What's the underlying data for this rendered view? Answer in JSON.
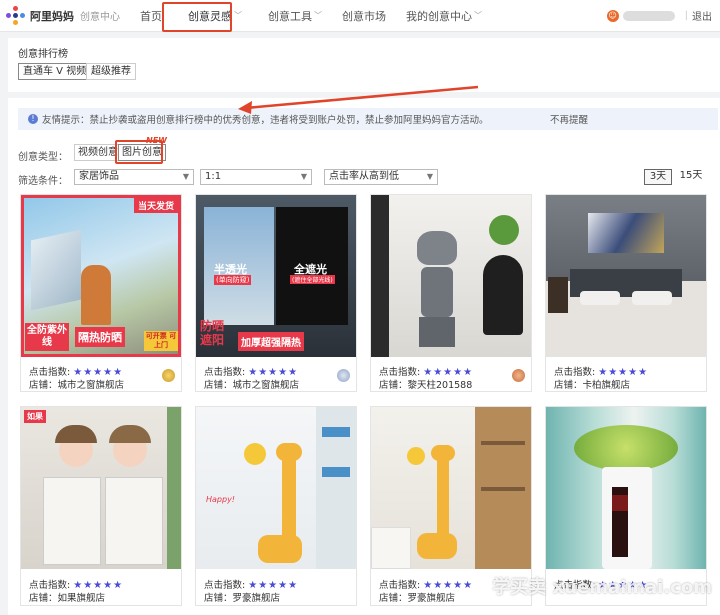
{
  "nav": {
    "logo": "阿里妈妈",
    "logo_sub": "创意中心",
    "items": [
      {
        "label": "首页",
        "dropdown": false
      },
      {
        "label": "创意灵感",
        "dropdown": true
      },
      {
        "label": "创意工具",
        "dropdown": true
      },
      {
        "label": "创意市场",
        "dropdown": false
      },
      {
        "label": "我的创意中心",
        "dropdown": true
      }
    ],
    "logout": "退出"
  },
  "ranking": {
    "title": "创意排行榜",
    "tabs": [
      "直通车 V 视频",
      "超级推荐"
    ]
  },
  "notice": {
    "text": "友情提示：禁止抄袭或盗用创意排行榜中的优秀创意，违者将受到账户处罚，禁止参加阿里妈妈官方活动。",
    "dismiss": "不再提醒"
  },
  "creative_type": {
    "label": "创意类型：",
    "options": [
      "视频创意",
      "图片创意"
    ],
    "new_badge": "NEW"
  },
  "filters": {
    "label": "筛选条件：",
    "category": "家居饰品",
    "ratio": "1:1",
    "sort": "点击率从高到低",
    "days": [
      "3天",
      "15天"
    ]
  },
  "cards": [
    {
      "index_label": "点击指数:",
      "stars": "★★★★★",
      "shop": "店铺：城市之窗旗舰店",
      "img_text": [
        "当天发货",
        "全防紫外线",
        "隔热防晒",
        "可开票 可上门"
      ]
    },
    {
      "index_label": "点击指数:",
      "stars": "★★★★★",
      "shop": "店铺：城市之窗旗舰店",
      "img_text": [
        "半透光",
        "(单向防窥)",
        "全遮光",
        "(遮住全部光线)",
        "防晒遮阳",
        "加厚超强隔热"
      ]
    },
    {
      "index_label": "点击指数:",
      "stars": "★★★★★",
      "shop": "店铺：黎天柱201588",
      "img_text": []
    },
    {
      "index_label": "点击指数:",
      "stars": "★★★★★",
      "shop": "店铺：卡柏旗舰店",
      "img_text": []
    },
    {
      "index_label": "点击指数:",
      "stars": "★★★★★",
      "shop": "店铺：如果旗舰店",
      "img_text": [
        "如果"
      ]
    },
    {
      "index_label": "点击指数:",
      "stars": "★★★★★",
      "shop": "店铺：罗豪旗舰店",
      "img_text": [
        "Happy!"
      ]
    },
    {
      "index_label": "点击指数:",
      "stars": "★★★★★",
      "shop": "店铺：罗豪旗舰店",
      "img_text": []
    },
    {
      "index_label": "点击指数:",
      "stars": "★★★★★",
      "shop": "",
      "img_text": []
    }
  ],
  "watermark": "学买卖 xuemaimai.com",
  "colors": {
    "accent": "#4a4bd6",
    "annotation": "#e0442a",
    "notice_bg": "#eef3fb"
  }
}
